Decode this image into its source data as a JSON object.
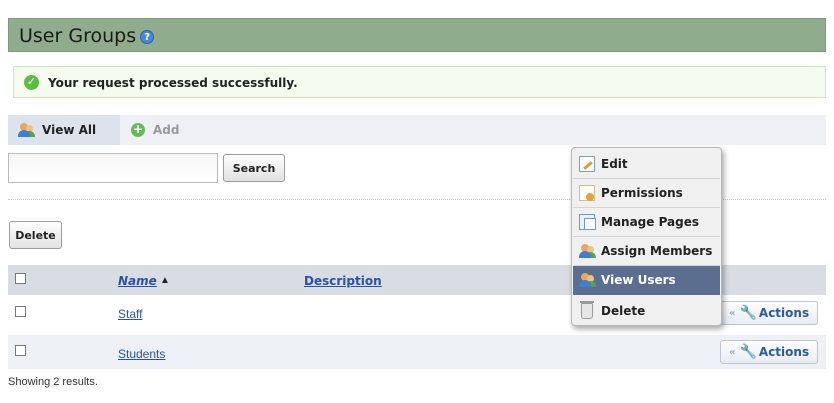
{
  "page": {
    "title": "User Groups",
    "help_glyph": "?"
  },
  "notice": {
    "message": "Your request processed successfully."
  },
  "tabs": {
    "view_all": "View All",
    "add": "Add"
  },
  "search": {
    "value": "",
    "placeholder": "",
    "button_label": "Search"
  },
  "bulk": {
    "delete_label": "Delete"
  },
  "table": {
    "columns": {
      "name": "Name",
      "description": "Description"
    },
    "sort_glyph": "▲",
    "rows": [
      {
        "name": "Staff",
        "description": "",
        "actions_label": "Actions"
      },
      {
        "name": "Students",
        "description": "",
        "actions_label": "Actions"
      }
    ]
  },
  "footer": {
    "results": "Showing 2 results."
  },
  "context_menu": {
    "items": [
      {
        "label": "Edit",
        "icon": "edit-icon"
      },
      {
        "label": "Permissions",
        "icon": "permissions-icon"
      },
      {
        "label": "Manage Pages",
        "icon": "pages-icon"
      },
      {
        "label": "Assign Members",
        "icon": "assign-members-icon"
      },
      {
        "label": "View Users",
        "icon": "view-users-icon",
        "active": true
      },
      {
        "label": "Delete",
        "icon": "trash-icon"
      }
    ]
  },
  "colors": {
    "header_bg": "#8fac8d",
    "success_bg": "#f4fbef",
    "link": "#2a52a8",
    "menu_active_bg": "#5c6e90"
  }
}
